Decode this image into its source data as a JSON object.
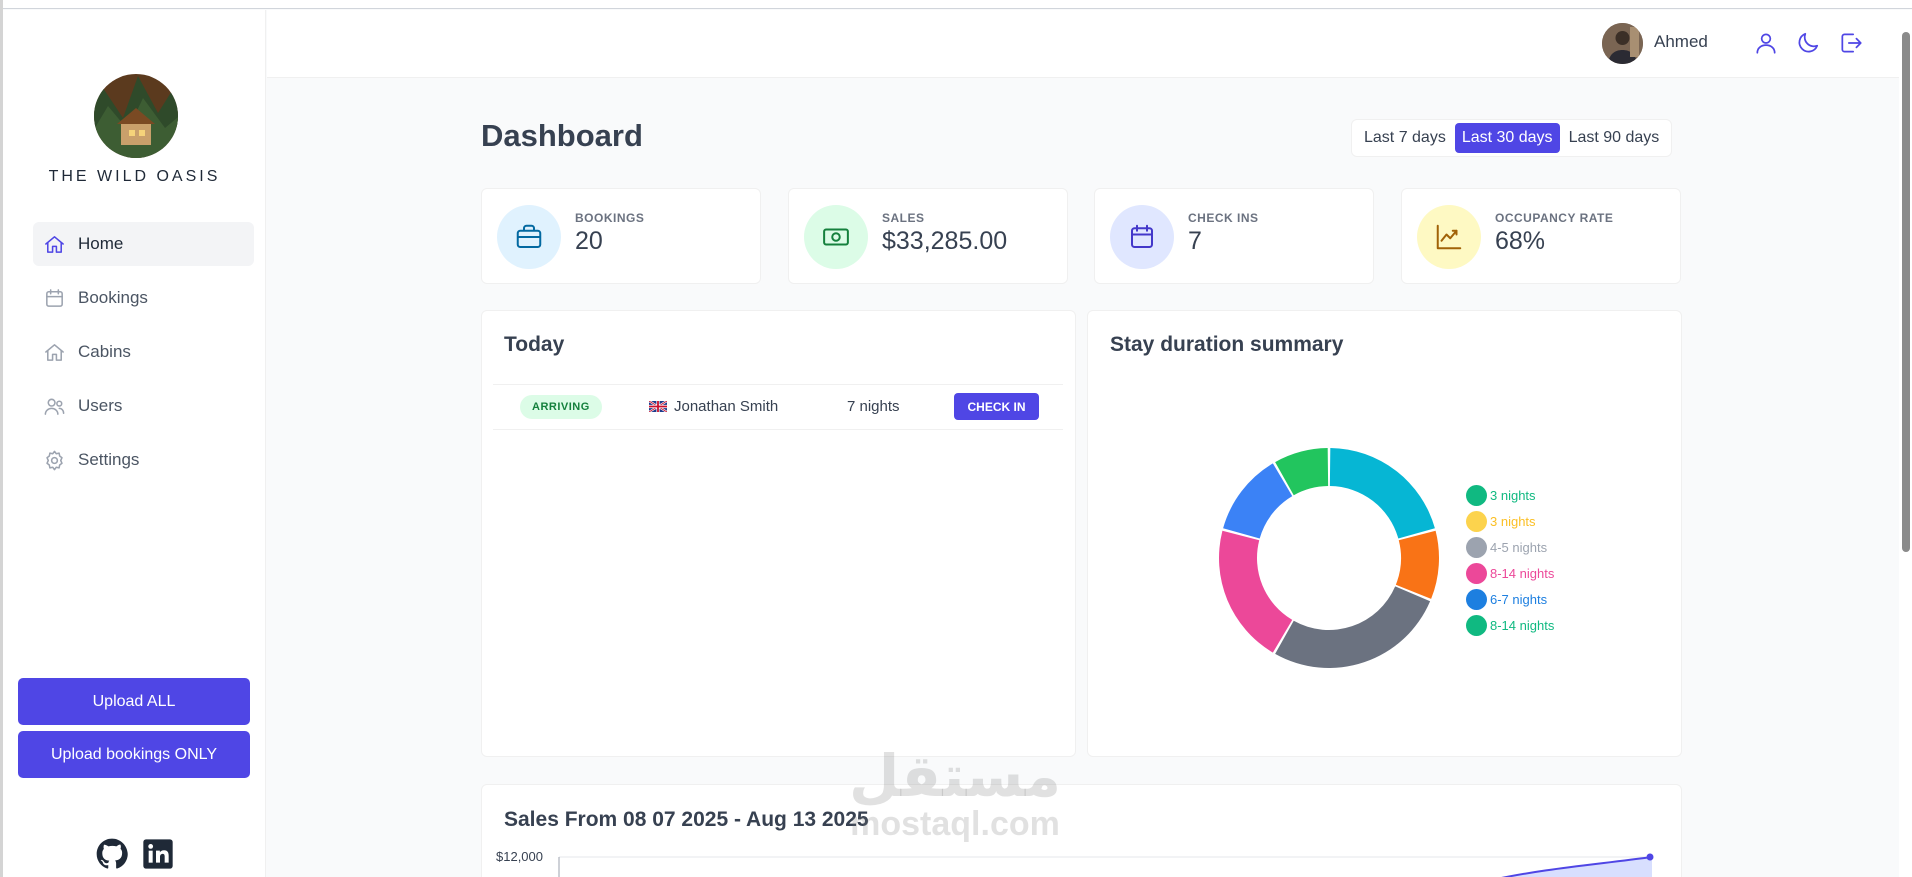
{
  "sidebar": {
    "brand": "THE WILD OASIS",
    "nav": [
      {
        "label": "Home",
        "icon": "home-icon",
        "active": true
      },
      {
        "label": "Bookings",
        "icon": "calendar-icon"
      },
      {
        "label": "Cabins",
        "icon": "home-icon"
      },
      {
        "label": "Users",
        "icon": "users-icon"
      },
      {
        "label": "Settings",
        "icon": "gear-icon"
      }
    ],
    "upload_all": "Upload ALL",
    "upload_bookings": "Upload bookings ONLY",
    "social": [
      "github-icon",
      "linkedin-icon"
    ]
  },
  "header": {
    "username": "Ahmed",
    "icons": [
      "user-icon",
      "moon-icon",
      "logout-icon"
    ]
  },
  "dashboard": {
    "title": "Dashboard",
    "filters": [
      {
        "label": "Last 7 days",
        "active": false
      },
      {
        "label": "Last 30 days",
        "active": true
      },
      {
        "label": "Last 90 days",
        "active": false
      }
    ],
    "stats": [
      {
        "label": "BOOKINGS",
        "value": "20",
        "icon": "briefcase-icon",
        "bg": "#e0f2fe",
        "fg": "#0369a1"
      },
      {
        "label": "SALES",
        "value": "$33,285.00",
        "icon": "banknotes-icon",
        "bg": "#dcfce7",
        "fg": "#15803d"
      },
      {
        "label": "CHECK INS",
        "value": "7",
        "icon": "calendar-icon",
        "bg": "#e0e7ff",
        "fg": "#4338ca"
      },
      {
        "label": "OCCUPANCY RATE",
        "value": "68%",
        "icon": "chart-bar-icon",
        "bg": "#fef9c3",
        "fg": "#a16207"
      }
    ]
  },
  "today": {
    "title": "Today",
    "rows": [
      {
        "status": "ARRIVING",
        "guest": "Jonathan Smith",
        "nights": "7 nights",
        "action": "CHECK IN"
      }
    ]
  },
  "stay": {
    "title": "Stay duration summary",
    "legend": [
      {
        "label": "3 nights",
        "color": "#10b981"
      },
      {
        "label": "3 nights",
        "color": "#fcd34d"
      },
      {
        "label": "4-5 nights",
        "color": "#9ca3af"
      },
      {
        "label": "8-14 nights",
        "color": "#ec4899"
      },
      {
        "label": "6-7 nights",
        "color": "#1d7fe0"
      },
      {
        "label": "8-14 nights",
        "color": "#10b981"
      }
    ]
  },
  "chart_data": {
    "type": "pie",
    "title": "Stay duration summary",
    "slices": [
      {
        "value": 20,
        "color": "#06b6d4"
      },
      {
        "value": 10,
        "color": "#f97316"
      },
      {
        "value": 26,
        "color": "#6b7280"
      },
      {
        "value": 20,
        "color": "#ec4899"
      },
      {
        "value": 12,
        "color": "#3b82f6"
      },
      {
        "value": 8,
        "color": "#22c55e"
      }
    ]
  },
  "sales": {
    "title": "Sales From 08 07 2025 - Aug 13 2025",
    "y_top_label": "$12,000"
  },
  "watermark": {
    "arabic": "مستقل",
    "latin": "mostaql.com"
  }
}
